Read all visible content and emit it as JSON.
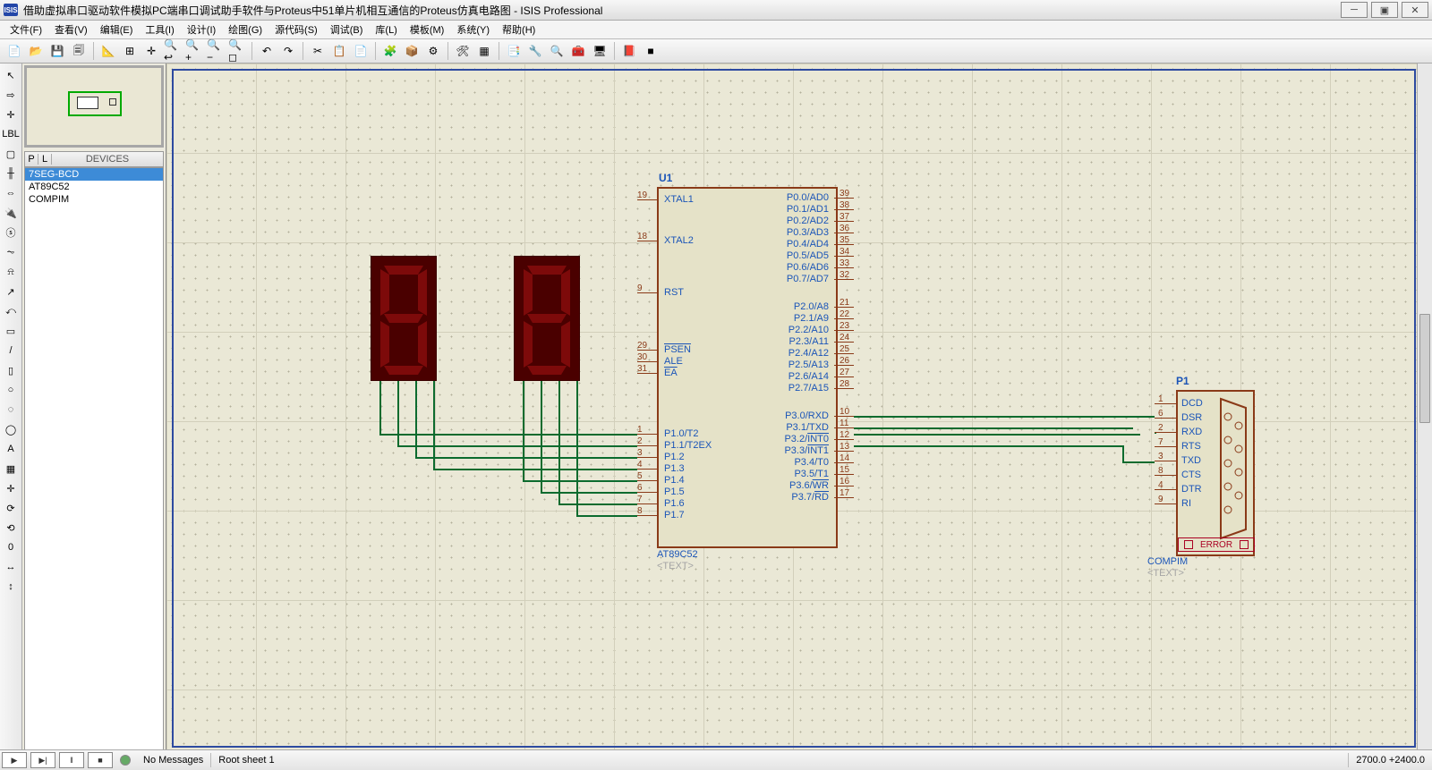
{
  "window": {
    "title": "借助虚拟串口驱动软件模拟PC端串口调试助手软件与Proteus中51单片机相互通信的Proteus仿真电路图 - ISIS Professional",
    "logo_text": "ISIS"
  },
  "menu": {
    "file": "文件(F)",
    "view": "查看(V)",
    "edit": "编辑(E)",
    "tool": "工具(I)",
    "design": "设计(I)",
    "draw": "绘图(G)",
    "source": "源代码(S)",
    "debug": "调试(B)",
    "library": "库(L)",
    "template": "模板(M)",
    "system": "系统(Y)",
    "help": "帮助(H)"
  },
  "toolbar_icons": [
    "📄",
    "📂",
    "💾",
    "🗐",
    "|",
    "📐",
    "⊞",
    "✛",
    "🔍↩",
    "🔍+",
    "🔍−",
    "🔍◻",
    "|",
    "↶",
    "↷",
    "|",
    "✂",
    "📋",
    "📄",
    "|",
    "🧩",
    "📦",
    "⚙",
    "|",
    "🛠",
    "▦",
    "|",
    "📑",
    "🔧",
    "🔍",
    "🧰",
    "🖥",
    "|",
    "📕",
    "■"
  ],
  "left_tools": [
    "↖",
    "⇨",
    "✛",
    "LBL",
    "▢",
    "╫",
    "⇔",
    "🔌",
    "ⓢ",
    "⏦",
    "⍾",
    "↗",
    "⤺",
    "▭",
    "/",
    "▯",
    "○",
    "◌",
    "◯",
    "A",
    "▦",
    "✛",
    "⟳",
    "⟲",
    "0",
    "↔",
    "↕"
  ],
  "devices": {
    "header_p": "P",
    "header_l": "L",
    "header_title": "DEVICES",
    "items": [
      "7SEG-BCD",
      "AT89C52",
      "COMPIM"
    ],
    "selected": 0
  },
  "status": {
    "no_messages": "No Messages",
    "sheet": "Root sheet 1",
    "coords": "2700.0  +2400.0"
  },
  "schematic": {
    "u1_ref": "U1",
    "u1_name": "AT89C52",
    "u1_text": "<TEXT>",
    "p1_ref": "P1",
    "p1_name": "COMPIM",
    "p1_text": "<TEXT>",
    "p1_error": "ERROR",
    "u1_left_pins": [
      {
        "num": "19",
        "name": "XTAL1"
      },
      {
        "num": "18",
        "name": "XTAL2"
      },
      {
        "num": "9",
        "name": "RST"
      },
      {
        "num": "29",
        "name": "PSEN",
        "over": true
      },
      {
        "num": "30",
        "name": "ALE"
      },
      {
        "num": "31",
        "name": "EA",
        "over": true
      },
      {
        "num": "1",
        "name": "P1.0/T2"
      },
      {
        "num": "2",
        "name": "P1.1/T2EX"
      },
      {
        "num": "3",
        "name": "P1.2"
      },
      {
        "num": "4",
        "name": "P1.3"
      },
      {
        "num": "5",
        "name": "P1.4"
      },
      {
        "num": "6",
        "name": "P1.5"
      },
      {
        "num": "7",
        "name": "P1.6"
      },
      {
        "num": "8",
        "name": "P1.7"
      }
    ],
    "u1_right_pins": [
      {
        "num": "39",
        "name": "P0.0/AD0"
      },
      {
        "num": "38",
        "name": "P0.1/AD1"
      },
      {
        "num": "37",
        "name": "P0.2/AD2"
      },
      {
        "num": "36",
        "name": "P0.3/AD3"
      },
      {
        "num": "35",
        "name": "P0.4/AD4"
      },
      {
        "num": "34",
        "name": "P0.5/AD5"
      },
      {
        "num": "33",
        "name": "P0.6/AD6"
      },
      {
        "num": "32",
        "name": "P0.7/AD7"
      },
      {
        "num": "21",
        "name": "P2.0/A8"
      },
      {
        "num": "22",
        "name": "P2.1/A9"
      },
      {
        "num": "23",
        "name": "P2.2/A10"
      },
      {
        "num": "24",
        "name": "P2.3/A11"
      },
      {
        "num": "25",
        "name": "P2.4/A12"
      },
      {
        "num": "26",
        "name": "P2.5/A13"
      },
      {
        "num": "27",
        "name": "P2.6/A14"
      },
      {
        "num": "28",
        "name": "P2.7/A15"
      },
      {
        "num": "10",
        "name": "P3.0/RXD"
      },
      {
        "num": "11",
        "name": "P3.1/TXD"
      },
      {
        "num": "12",
        "name": "P3.2/INT0",
        "over": "tail"
      },
      {
        "num": "13",
        "name": "P3.3/INT1",
        "over": "tail"
      },
      {
        "num": "14",
        "name": "P3.4/T0"
      },
      {
        "num": "15",
        "name": "P3.5/T1"
      },
      {
        "num": "16",
        "name": "P3.6/WR",
        "over": "tail"
      },
      {
        "num": "17",
        "name": "P3.7/RD",
        "over": "tail"
      }
    ],
    "p1_pins": [
      {
        "num": "1",
        "name": "DCD"
      },
      {
        "num": "6",
        "name": "DSR"
      },
      {
        "num": "2",
        "name": "RXD"
      },
      {
        "num": "7",
        "name": "RTS"
      },
      {
        "num": "3",
        "name": "TXD"
      },
      {
        "num": "8",
        "name": "CTS"
      },
      {
        "num": "4",
        "name": "DTR"
      },
      {
        "num": "9",
        "name": "RI"
      }
    ]
  }
}
